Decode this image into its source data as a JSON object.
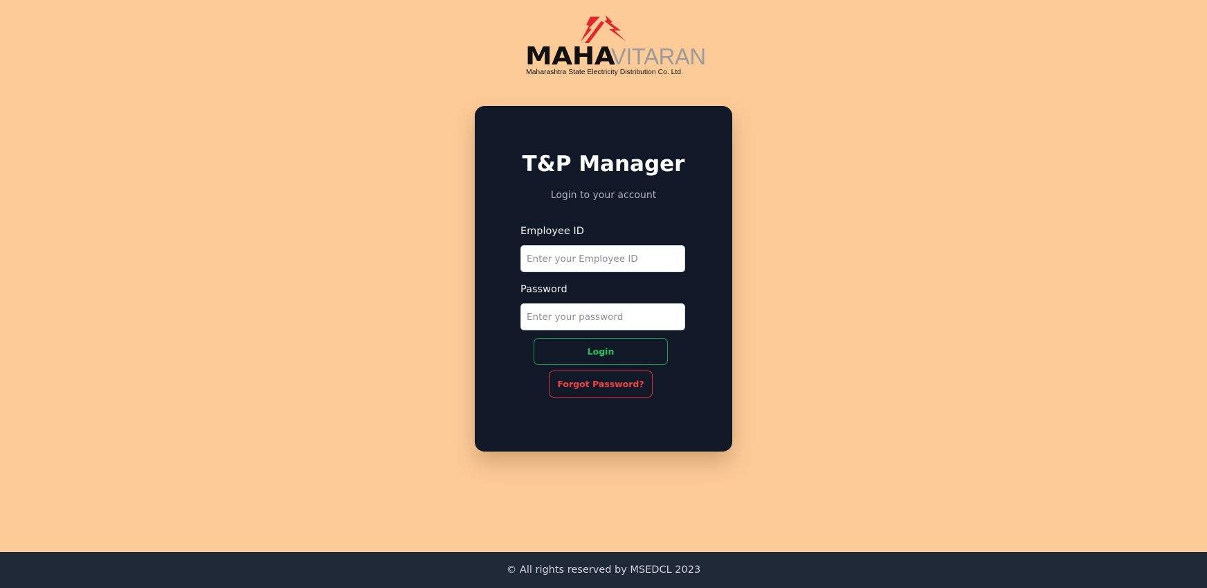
{
  "logo": {
    "brand_primary": "MAHA",
    "brand_secondary": "VITARAN",
    "tagline": "Maharashtra State Electricity Distribution Co. Ltd.",
    "icon": "lightning-bolts-icon",
    "bolt_color": "#e3262a"
  },
  "login_card": {
    "title": "T&P Manager",
    "subtitle": "Login to your account",
    "employee_id": {
      "label": "Employee ID",
      "placeholder": "Enter your Employee ID",
      "value": ""
    },
    "password": {
      "label": "Password",
      "placeholder": "Enter your password",
      "value": ""
    },
    "login_button": "Login",
    "forgot_button": "Forgot Password?"
  },
  "footer": {
    "text": "© All rights reserved by MSEDCL 2023"
  },
  "colors": {
    "page_background": "#fdcb98",
    "card_background": "#111827",
    "footer_background": "#1f2937",
    "login_accent": "#22c55e",
    "forgot_accent": "#ef4444"
  }
}
